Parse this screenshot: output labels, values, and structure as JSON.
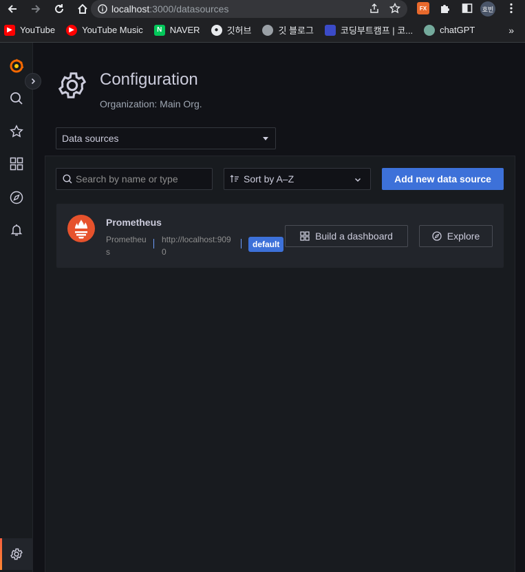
{
  "browser": {
    "url_host": "localhost",
    "url_path": ":3000/datasources",
    "profile_initials": "호빈",
    "bookmarks": [
      {
        "label": "YouTube"
      },
      {
        "label": "YouTube Music"
      },
      {
        "label": "NAVER"
      },
      {
        "label": "깃허브"
      },
      {
        "label": "깃 블로그"
      },
      {
        "label": "코딩부트캠프 | 코..."
      },
      {
        "label": "chatGPT"
      }
    ],
    "more_label": "»"
  },
  "header": {
    "title": "Configuration",
    "subtitle": "Organization: Main Org."
  },
  "section_select": {
    "value": "Data sources"
  },
  "toolbar": {
    "search_placeholder": "Search by name or type",
    "sort_label": "Sort by A–Z",
    "add_button_label": "Add new data source"
  },
  "datasources": [
    {
      "name": "Prometheus",
      "type": "Prometheus",
      "url": "http://localhost:9090",
      "badge": "default",
      "build_label": "Build a dashboard",
      "explore_label": "Explore"
    }
  ],
  "colors": {
    "primary": "#3d71d9",
    "brand_orange": "#f55f3e",
    "prometheus": "#e6522c"
  }
}
